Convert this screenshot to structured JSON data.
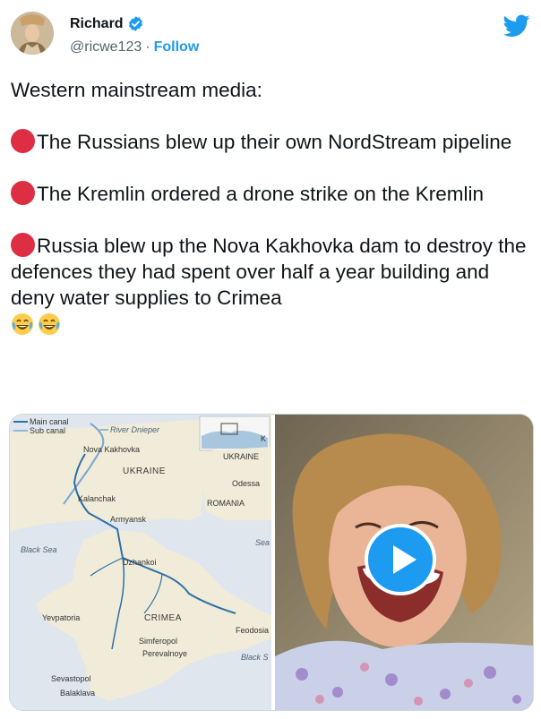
{
  "author": {
    "name": "Richard",
    "handle": "@ricwe123",
    "separator": "·",
    "follow_label": "Follow"
  },
  "tweet": {
    "intro": "Western mainstream media:",
    "points": [
      {
        "icon": "red-circle",
        "text": "The Russians blew up their own NordStream pipeline"
      },
      {
        "icon": "red-circle",
        "text": "The Kremlin ordered a drone strike on the Kremlin"
      },
      {
        "icon": "red-circle",
        "text": "Russia blew up the Nova Kakhovka dam to destroy the defences they had spent over half a year building and deny water supplies to Crimea"
      }
    ],
    "trailing_emoji": [
      "face-with-tears-of-joy",
      "face-with-tears-of-joy"
    ]
  },
  "map": {
    "legend": {
      "main": "Main canal",
      "sub": "Sub canal"
    },
    "river": "River Dnieper",
    "places": {
      "nova_kakhovka": "Nova Kakhovka",
      "kalanchak": "Kalanchak",
      "armyansk": "Armyansk",
      "dzhankoi": "Dzhankoi",
      "yevpatoria": "Yevpatoria",
      "simferopol": "Simferopol",
      "perevalnoye": "Perevalnoye",
      "feodosia": "Feodosia",
      "sevastopol": "Sevastopol",
      "balaklava": "Balaklava",
      "odessa": "Odessa",
      "k": "K"
    },
    "regions": {
      "ukraine": "UKRAINE",
      "crimea": "CRIMEA",
      "inset_ukraine": "UKRAINE",
      "romania": "ROMANIA"
    },
    "seas": {
      "black_sea": "Black Sea",
      "inset_sea": "Sea",
      "black_s": "Black S"
    }
  },
  "colors": {
    "accent": "#1d9bf0",
    "text": "#0f1419",
    "muted": "#536471",
    "dot": "#dd2e44",
    "canal": "#2e6fa6"
  }
}
